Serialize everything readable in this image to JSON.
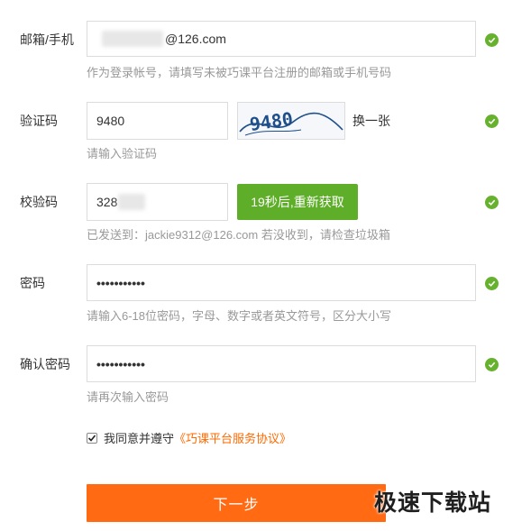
{
  "colors": {
    "accent": "#ff6a13",
    "success": "#66b12e",
    "link": "#ff6a00"
  },
  "fields": {
    "email": {
      "label": "邮箱/手机",
      "value_suffix": "@126.com",
      "hint": "作为登录帐号，请填写未被巧课平台注册的邮箱或手机号码"
    },
    "captcha": {
      "label": "验证码",
      "value": "9480",
      "change_label": "换一张",
      "hint": "请输入验证码",
      "image_text": "9480"
    },
    "sms": {
      "label": "校验码",
      "value": "328",
      "button_label": "19秒后,重新获取",
      "hint": "已发送到：jackie9312@126.com 若没收到，请检查垃圾箱"
    },
    "password": {
      "label": "密码",
      "value": "•••••••••••",
      "hint": "请输入6-18位密码，字母、数字或者英文符号，区分大小写"
    },
    "confirm": {
      "label": "确认密码",
      "value": "•••••••••••",
      "hint": "请再次输入密码"
    }
  },
  "agreement": {
    "prefix": "我同意并遵守",
    "link": "《巧课平台服务协议》",
    "checked": true
  },
  "next_label": "下一步",
  "watermark": "极速下载站"
}
